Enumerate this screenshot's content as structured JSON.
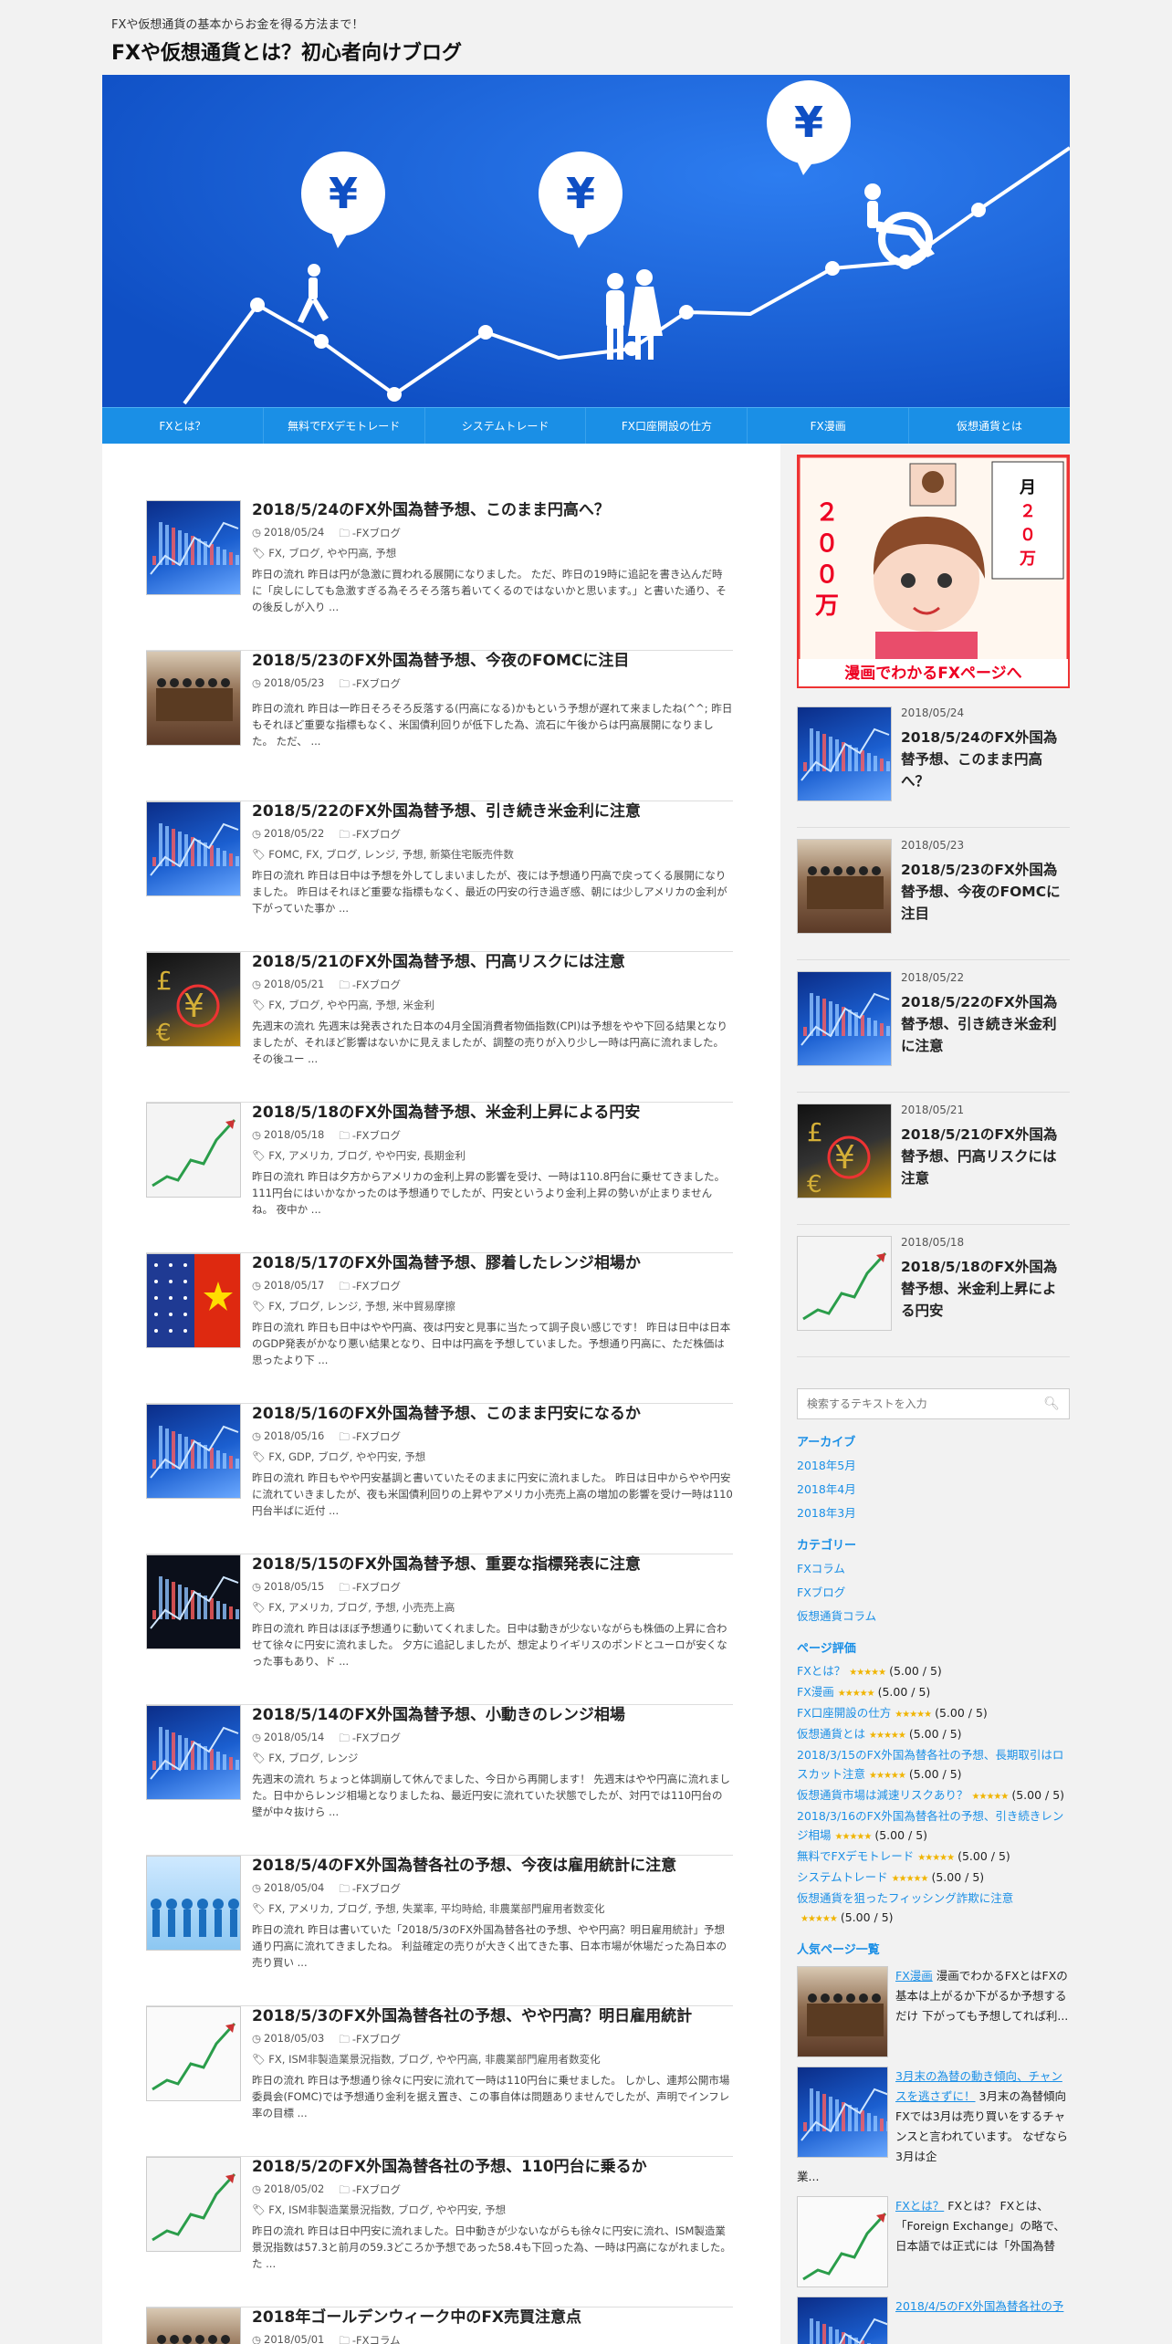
{
  "header": {
    "tagline": "FXや仮想通貨の基本からお金を得る方法まで！",
    "title": "FXや仮想通貨とは？初心者向けブログ"
  },
  "nav": [
    "FXとは？",
    "無料でFXデモトレード",
    "システムトレード",
    "FX口座開設の仕方",
    "FX漫画",
    "仮想通貨とは"
  ],
  "posts": [
    {
      "title": "2018/5/24のFX外国為替予想、このまま円高へ？",
      "date": "2018/05/24",
      "category": "-FXブログ",
      "tags": "FX, ブログ, やや円高, 予想",
      "excerpt": "昨日の流れ 昨日は円が急激に買われる展開になりました。 ただ、昨日の19時に追記を書き込んだ時に「戻しにしても急激すぎる為そろそろ落ち着いてくるのではないかと思います。」と書いた通り、その後反しが入り ..."
    },
    {
      "title": "2018/5/23のFX外国為替予想、今夜のFOMCに注目",
      "date": "2018/05/23",
      "category": "-FXブログ",
      "tags": "",
      "excerpt": "昨日の流れ 昨日は一昨日そろそろ反落する(円高になる)かもという予想が遅れて来ましたね(^^; 昨日もそれほど重要な指標もなく、米国債利回りが低下した為、流石に午後からは円高展開になりました。 ただ、 ..."
    },
    {
      "title": "2018/5/22のFX外国為替予想、引き続き米金利に注意",
      "date": "2018/05/22",
      "category": "-FXブログ",
      "tags": "FOMC, FX, ブログ, レンジ, 予想, 新築住宅販売件数",
      "excerpt": "昨日の流れ 昨日は日中は予想を外してしまいましたが、夜には予想通り円高で戻ってくる展開になりました。 昨日はそれほど重要な指標もなく、最近の円安の行き過ぎ感、朝には少しアメリカの金利が下がっていた事か ..."
    },
    {
      "title": "2018/5/21のFX外国為替予想、円高リスクには注意",
      "date": "2018/05/21",
      "category": "-FXブログ",
      "tags": "FX, ブログ, やや円高, 予想, 米金利",
      "excerpt": "先週末の流れ 先週末は発表された日本の4月全国消費者物価指数(CPI)は予想をやや下回る結果となりましたが、それほど影響はないかに見えましたが、調整の売りが入り少し一時は円高に流れました。 その後ユー ..."
    },
    {
      "title": "2018/5/18のFX外国為替予想、米金利上昇による円安",
      "date": "2018/05/18",
      "category": "-FXブログ",
      "tags": "FX, アメリカ, ブログ, やや円安, 長期金利",
      "excerpt": "昨日の流れ 昨日は夕方からアメリカの金利上昇の影響を受け、一時は110.8円台に乗せてきました。 111円台にはいかなかったのは予想通りでしたが、円安というより金利上昇の勢いが止まりませんね。 夜中か ..."
    },
    {
      "title": "2018/5/17のFX外国為替予想、膠着したレンジ相場か",
      "date": "2018/05/17",
      "category": "-FXブログ",
      "tags": "FX, ブログ, レンジ, 予想, 米中貿易摩擦",
      "excerpt": "昨日の流れ 昨日も日中はやや円高、夜は円安と見事に当たって調子良い感じです！ 昨日は日中は日本のGDP発表がかなり悪い結果となり、日中は円高を予想していました。予想通り円高に、ただ株価は思ったより下 ..."
    },
    {
      "title": "2018/5/16のFX外国為替予想、このまま円安になるか",
      "date": "2018/05/16",
      "category": "-FXブログ",
      "tags": "FX, GDP, ブログ, やや円安, 予想",
      "excerpt": "昨日の流れ 昨日もやや円安基調と書いていたそのままに円安に流れました。 昨日は日中からやや円安に流れていきましたが、夜も米国債利回りの上昇やアメリカ小売売上高の増加の影響を受け一時は110円台半ばに近付 ..."
    },
    {
      "title": "2018/5/15のFX外国為替予想、重要な指標発表に注意",
      "date": "2018/05/15",
      "category": "-FXブログ",
      "tags": "FX, アメリカ, ブログ, 予想, 小売売上高",
      "excerpt": "昨日の流れ 昨日はほぼ予想通りに動いてくれました。日中は動きが少ないながらも株価の上昇に合わせて徐々に円安に流れました。 夕方に追記しましたが、想定よりイギリスのポンドとユーロが安くなった事もあり、ド ..."
    },
    {
      "title": "2018/5/14のFX外国為替予想、小動きのレンジ相場",
      "date": "2018/05/14",
      "category": "-FXブログ",
      "tags": "FX, ブログ, レンジ",
      "excerpt": "先週末の流れ ちょっと体調崩して休んでました、今日から再開します！ 先週末はやや円高に流れました。日中からレンジ相場となりましたね、最近円安に流れていた状態でしたが、対円では110円台の壁が中々抜けら ..."
    },
    {
      "title": "2018/5/4のFX外国為替各社の予想、今夜は雇用統計に注意",
      "date": "2018/05/04",
      "category": "-FXブログ",
      "tags": "FX, アメリカ, ブログ, 予想, 失業率, 平均時給, 非農業部門雇用者数変化",
      "excerpt": "昨日の流れ 昨日は書いていた「2018/5/3のFX外国為替各社の予想、やや円高？明日雇用統計」予想通り円高に流れてきましたね。 利益確定の売りが大きく出てきた事、日本市場が休場だった為日本の売り買い ..."
    },
    {
      "title": "2018/5/3のFX外国為替各社の予想、やや円高？明日雇用統計",
      "date": "2018/05/03",
      "category": "-FXブログ",
      "tags": "FX, ISM非製造業景況指数, ブログ, やや円高, 非農業部門雇用者数変化",
      "excerpt": "昨日の流れ 昨日は予想通り徐々に円安に流れて一時は110円台に乗せました。 しかし、連邦公開市場委員会(FOMC)では予想通り金利を据え置き、この事自体は問題ありませんでしたが、声明でインフレ率の目標 ..."
    },
    {
      "title": "2018/5/2のFX外国為替各社の予想、110円台に乗るか",
      "date": "2018/05/02",
      "category": "-FXブログ",
      "tags": "FX, ISM非製造業景況指数, ブログ, やや円安, 予想",
      "excerpt": "昨日の流れ 昨日は日中円安に流れました。日中動きが少ないながらも徐々に円安に流れ、ISM製造業景況指数は57.3と前月の59.3どころか予想であった58.4も下回った為、一時は円高にながれました。 た ..."
    },
    {
      "title": "2018年ゴールデンウィーク中のFX売買注意点",
      "date": "2018/05/01",
      "category": "-FXコラム",
      "tags": "",
      "excerpt": ""
    }
  ],
  "sidebar": {
    "banner_caption": "漫画でわかるFXページへ",
    "recent": [
      {
        "date": "2018/05/24",
        "title": "2018/5/24のFX外国為替予想、このまま円高へ？"
      },
      {
        "date": "2018/05/23",
        "title": "2018/5/23のFX外国為替予想、今夜のFOMCに注目"
      },
      {
        "date": "2018/05/22",
        "title": "2018/5/22のFX外国為替予想、引き続き米金利に注意"
      },
      {
        "date": "2018/05/21",
        "title": "2018/5/21のFX外国為替予想、円高リスクには注意"
      },
      {
        "date": "2018/05/18",
        "title": "2018/5/18のFX外国為替予想、米金利上昇による円安"
      }
    ],
    "search_placeholder": "検索するテキストを入力",
    "archive_title": "アーカイブ",
    "archives": [
      "2018年5月",
      "2018年4月",
      "2018年3月"
    ],
    "category_title": "カテゴリー",
    "categories": [
      "FXコラム",
      "FXブログ",
      "仮想通貨コラム"
    ],
    "rating_title": "ページ評価",
    "ratings": [
      {
        "label": "FXとは？",
        "score": "(5.00 / 5)"
      },
      {
        "label": "FX漫画",
        "score": "(5.00 / 5)"
      },
      {
        "label": "FX口座開設の仕方",
        "score": "(5.00 / 5)"
      },
      {
        "label": "仮想通貨とは",
        "score": "(5.00 / 5)"
      },
      {
        "label": "2018/3/15のFX外国為替各社の予想、長期取引はロスカット注意",
        "score": "(5.00 / 5)"
      },
      {
        "label": "仮想通貨市場は減速リスクあり？",
        "score": "(5.00 / 5)"
      },
      {
        "label": "2018/3/16のFX外国為替各社の予想、引き続きレンジ相場",
        "score": "(5.00 / 5)"
      },
      {
        "label": "無料でFXデモトレード",
        "score": "(5.00 / 5)"
      },
      {
        "label": "システムトレード",
        "score": "(5.00 / 5)"
      },
      {
        "label": "仮想通貨を狙ったフィッシング詐欺に注意",
        "score": "(5.00 / 5)"
      }
    ],
    "popular_title": "人気ページ一覧",
    "popular": [
      {
        "link": "FX漫画",
        "text": "漫画でわかるFXとはFXの基本は上がるか下がるか予想するだけ 下がっても予想してれば利...",
        "cont": ""
      },
      {
        "link": "3月末の為替の動き傾向、チャンスを逃さずに！",
        "text": "3月末の為替傾向 FXでは3月は売り買いをするチャンスと言われています。 なぜなら3月は企",
        "cont": "業..."
      },
      {
        "link": "FXとは？",
        "text": "FXとは？ FXとは、「Foreign Exchange」の略で、日本語では正式には「外国為替",
        "cont": ""
      },
      {
        "link": "2018/4/5のFX外国為替各社の予",
        "text": "",
        "cont": ""
      }
    ]
  }
}
